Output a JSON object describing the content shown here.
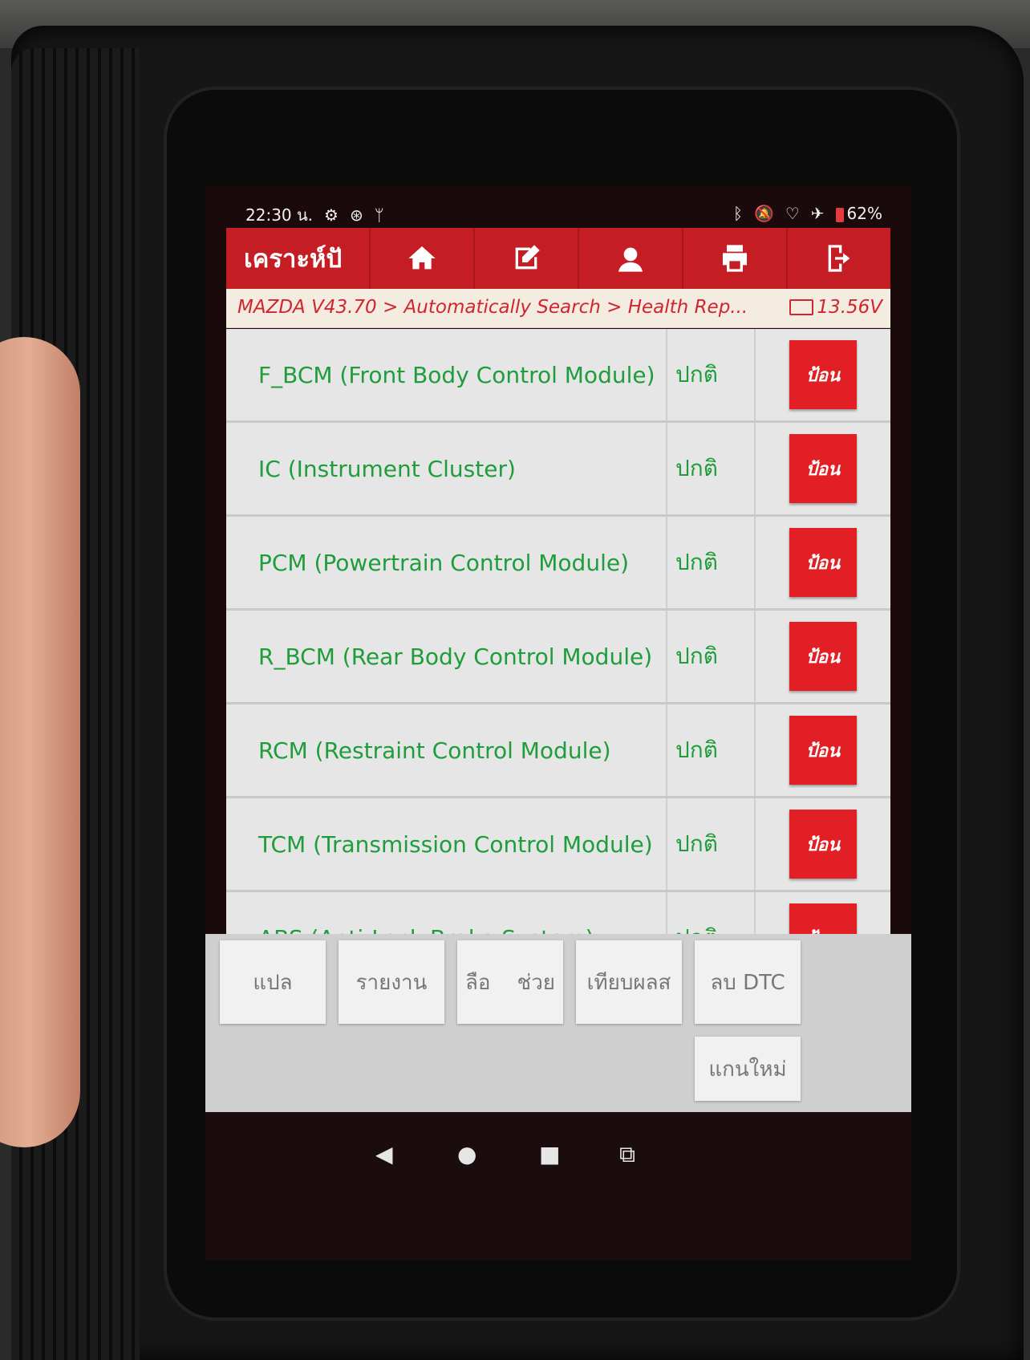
{
  "status_bar": {
    "time": "22:30 น.",
    "left_icons": [
      "gear-icon",
      "bluetooth-circle-icon",
      "usb-icon"
    ],
    "right_icons": [
      "bluetooth-icon",
      "mute-icon",
      "wifi-icon",
      "airplane-icon",
      "battery-icon"
    ],
    "battery": "62%"
  },
  "toolbar": {
    "title": "เคราะห์ปั",
    "buttons": [
      "home-icon",
      "edit-icon",
      "user-icon",
      "print-icon",
      "exit-icon"
    ]
  },
  "breadcrumb": {
    "path": "MAZDA V43.70 > Automatically Search > Health Rep...",
    "voltage": "13.56V"
  },
  "modules": [
    {
      "name": "F_BCM (Front Body Control Module)",
      "status": "ปกติ",
      "action": "ป้อน"
    },
    {
      "name": "IC (Instrument Cluster)",
      "status": "ปกติ",
      "action": "ป้อน"
    },
    {
      "name": "PCM (Powertrain Control Module)",
      "status": "ปกติ",
      "action": "ป้อน"
    },
    {
      "name": "R_BCM (Rear Body Control Module)",
      "status": "ปกติ",
      "action": "ป้อน"
    },
    {
      "name": "RCM (Restraint Control Module)",
      "status": "ปกติ",
      "action": "ป้อน"
    },
    {
      "name": "TCM (Transmission Control Module)",
      "status": "ปกติ",
      "action": "ป้อน"
    },
    {
      "name": "ABS (Anti-Lock Brake System)",
      "status": "ปกติ",
      "action": "ป้อน"
    }
  ],
  "bottom_buttons": {
    "translate": "แปล",
    "report": "รายงาน",
    "help": "ลือ    ช่วย",
    "compare": "เทียบผลส",
    "clear_dtc": "ลบ DTC",
    "rescan": "แกนใหม่"
  },
  "colors": {
    "toolbar": "#c51d24",
    "module_text": "#1f9d3c",
    "enter_button": "#e21f25",
    "breadcrumb_text": "#d0262d"
  }
}
